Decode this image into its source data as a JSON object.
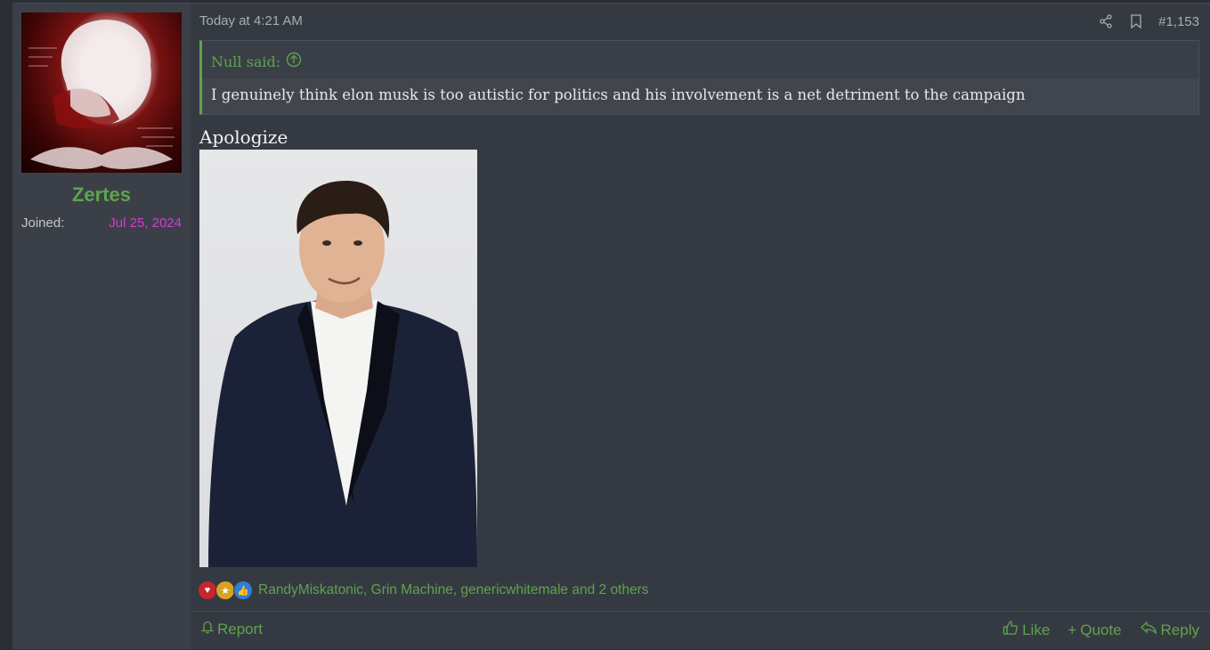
{
  "user": {
    "username": "Zertes",
    "joined_label": "Joined:",
    "joined_date": "Jul 25, 2024",
    "avatar_icon": "avatar-image"
  },
  "post": {
    "timestamp": "Today at 4:21 AM",
    "number": "#1,153",
    "share_icon": "share-icon",
    "bookmark_icon": "bookmark-icon",
    "quote": {
      "author_said": "Null said:",
      "text": "I genuinely think elon musk is too autistic for politics and his involvement is a net detriment to the campaign"
    },
    "body_text": "Apologize",
    "reactions": {
      "icons": [
        "heart-icon",
        "medal-icon",
        "thumbs-up-icon"
      ],
      "names": "RandyMiskatonic, Grin Machine, genericwhitemale and 2 others"
    }
  },
  "footer": {
    "report": "Report",
    "like": "Like",
    "quote": "Quote",
    "reply": "Reply"
  },
  "colors": {
    "accent_green": "#5fa34b",
    "joined_magenta": "#d43ad4",
    "background": "#353a42"
  }
}
